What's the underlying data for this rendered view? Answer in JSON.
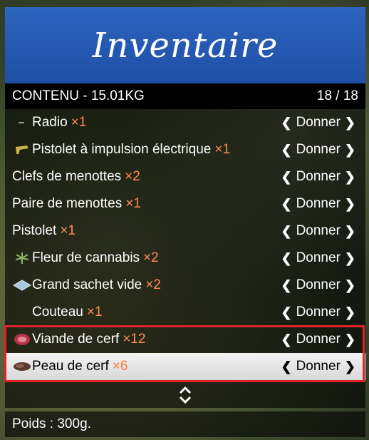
{
  "header": {
    "title": "Inventaire"
  },
  "subheader": {
    "contents_label": "CONTENU - 15.01KG",
    "count": "18 / 18"
  },
  "items": [
    {
      "name": "Radio",
      "qty": "×1",
      "icon": "radio-icon",
      "action": "Donner"
    },
    {
      "name": "Pistolet à impulsion électrique",
      "qty": "×1",
      "icon": "taser-icon",
      "action": "Donner"
    },
    {
      "name": "Clefs de menottes",
      "qty": "×2",
      "icon": "",
      "action": "Donner"
    },
    {
      "name": "Paire de menottes",
      "qty": "×1",
      "icon": "",
      "action": "Donner"
    },
    {
      "name": "Pistolet",
      "qty": "×1",
      "icon": "",
      "action": "Donner"
    },
    {
      "name": "Fleur de cannabis",
      "qty": "×2",
      "icon": "cannabis-icon",
      "action": "Donner"
    },
    {
      "name": "Grand sachet vide",
      "qty": "×2",
      "icon": "bag-icon",
      "action": "Donner"
    },
    {
      "name": "Couteau",
      "qty": "×1",
      "icon": "knife-icon",
      "action": "Donner"
    },
    {
      "name": "Viande de cerf",
      "qty": "×12",
      "icon": "meat-icon",
      "action": "Donner"
    },
    {
      "name": "Peau de cerf",
      "qty": "×6",
      "icon": "hide-icon",
      "action": "Donner"
    }
  ],
  "selected_index": 9,
  "footer": {
    "weight": "Poids : 300g."
  },
  "colors": {
    "banner": "#1f4fa6",
    "qty": "#ff8b5c",
    "highlight": "#e0222a"
  }
}
